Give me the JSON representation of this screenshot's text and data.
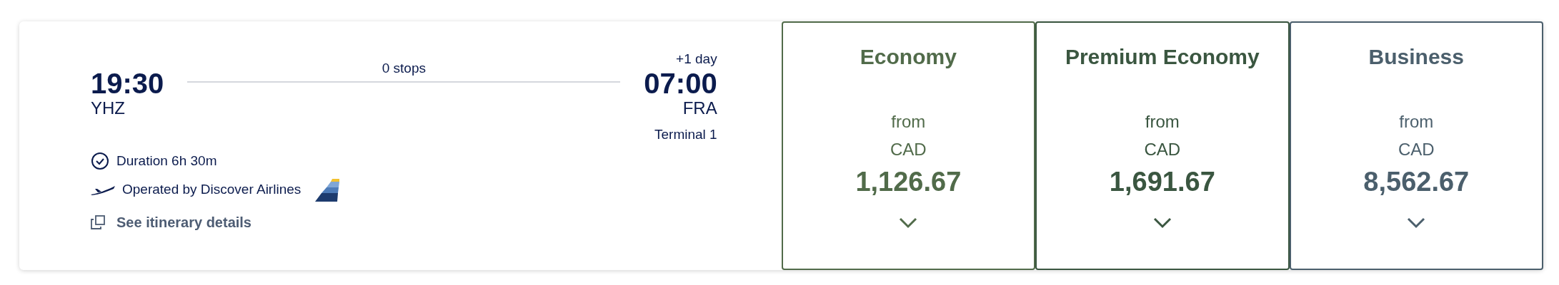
{
  "flight": {
    "departure": {
      "time": "19:30",
      "airport": "YHZ"
    },
    "stops": "0 stops",
    "arrival": {
      "day_offset": "+1 day",
      "time": "07:00",
      "airport": "FRA",
      "terminal": "Terminal 1"
    },
    "duration": "Duration 6h 30m",
    "operator": "Operated by Discover Airlines",
    "details_link": "See itinerary details"
  },
  "fares": [
    {
      "cabin": "Economy",
      "prefix": "from",
      "currency": "CAD",
      "price": "1,126.67",
      "color": "#516b4a"
    },
    {
      "cabin": "Premium Economy",
      "prefix": "from",
      "currency": "CAD",
      "price": "1,691.67",
      "color": "#3a5640"
    },
    {
      "cabin": "Business",
      "prefix": "from",
      "currency": "CAD",
      "price": "8,562.67",
      "color": "#4b5f6c"
    }
  ]
}
